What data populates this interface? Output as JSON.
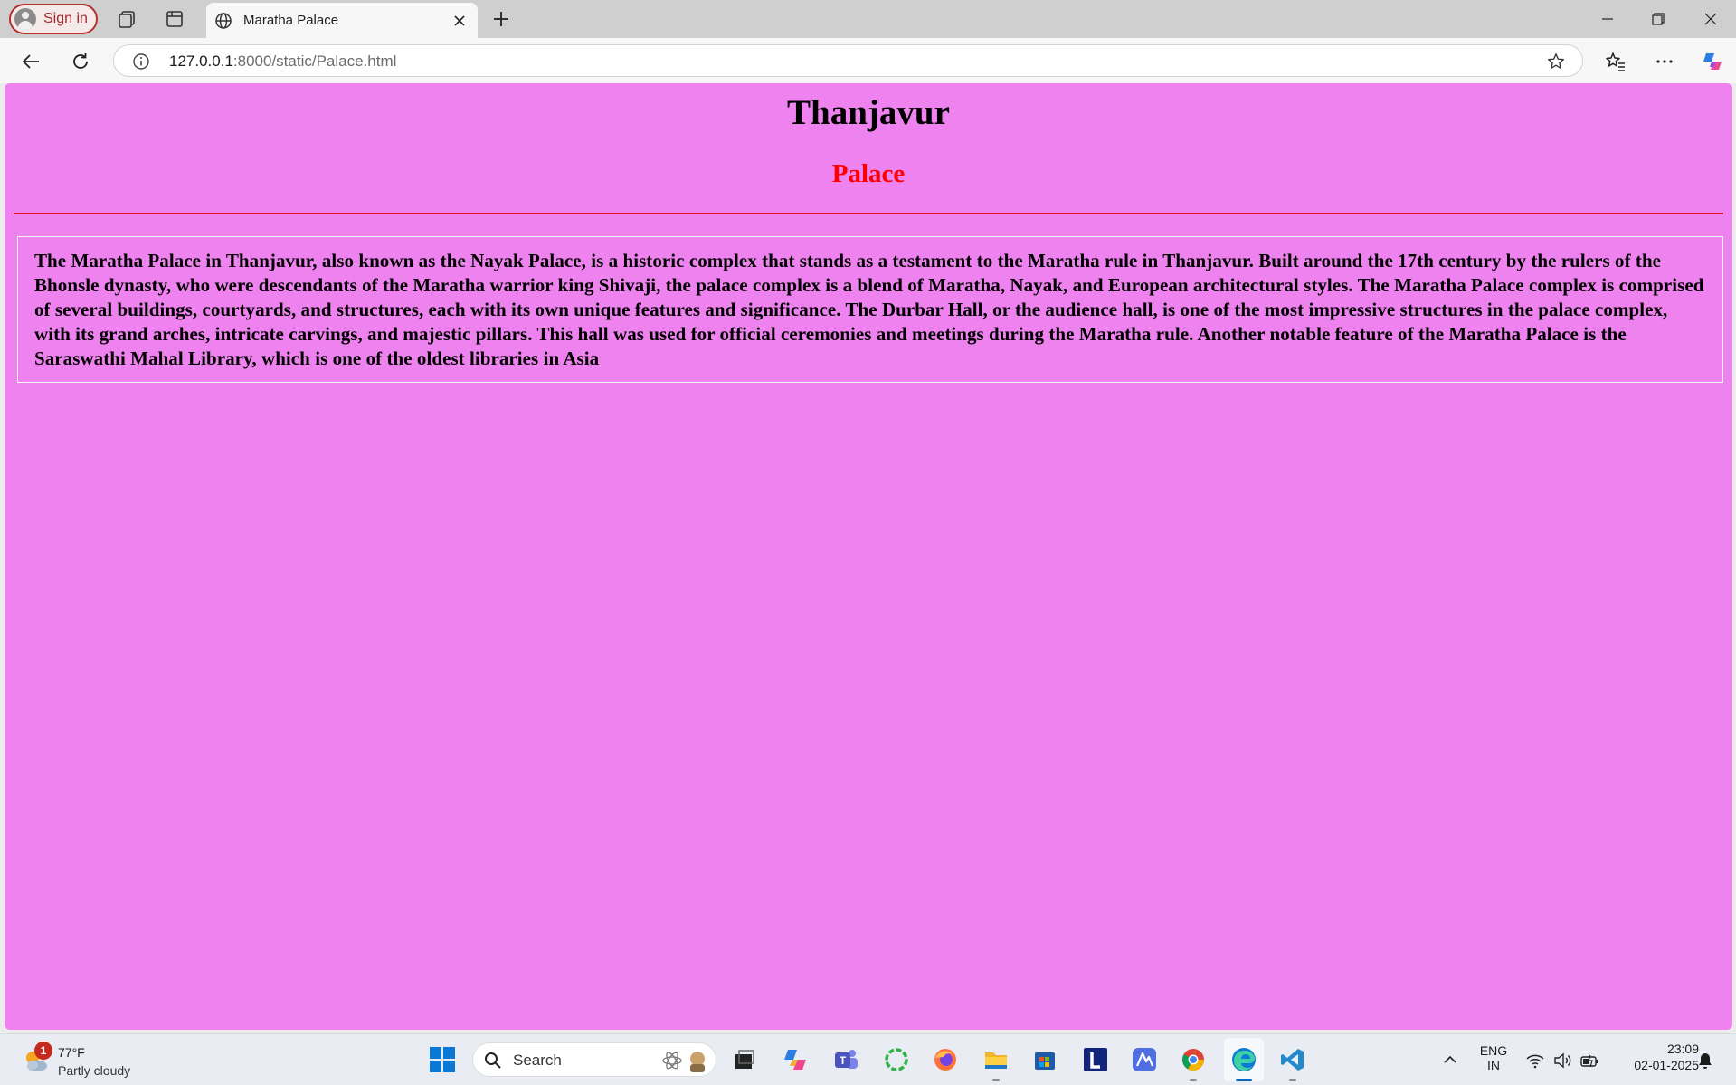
{
  "browser": {
    "sign_in_label": "Sign in",
    "tab_title": "Maratha Palace",
    "url_host": "127.0.0.1",
    "url_path": ":8000/static/Palace.html"
  },
  "page": {
    "heading": "Thanjavur",
    "subheading": "Palace",
    "paragraph": "The Maratha Palace in Thanjavur, also known as the Nayak Palace, is a historic complex that stands as a testament to the Maratha rule in Thanjavur. Built around the 17th century by the rulers of the Bhonsle dynasty, who were descendants of the Maratha warrior king Shivaji, the palace complex is a blend of Maratha, Nayak, and European architectural styles. The Maratha Palace complex is comprised of several buildings, courtyards, and structures, each with its own unique features and significance. The Durbar Hall, or the audience hall, is one of the most impressive structures in the palace complex, with its grand arches, intricate carvings, and majestic pillars. This hall was used for official ceremonies and meetings during the Maratha rule. Another notable feature of the Maratha Palace is the Saraswathi Mahal Library, which is one of the oldest libraries in Asia",
    "background_color": "#ee82ee",
    "subheading_color": "#ff0000"
  },
  "taskbar": {
    "weather_badge": "1",
    "temperature": "77°F",
    "condition": "Partly cloudy",
    "search_label": "Search",
    "language_line1": "ENG",
    "language_line2": "IN",
    "time": "23:09",
    "date": "02-01-2025",
    "apps": [
      "windows-start",
      "search",
      "file-explorer-dark",
      "copilot",
      "teams",
      "app-green-ring",
      "firefox",
      "file-explorer",
      "microsoft-store",
      "l-app",
      "vector-app",
      "chrome",
      "edge",
      "vscode"
    ]
  }
}
